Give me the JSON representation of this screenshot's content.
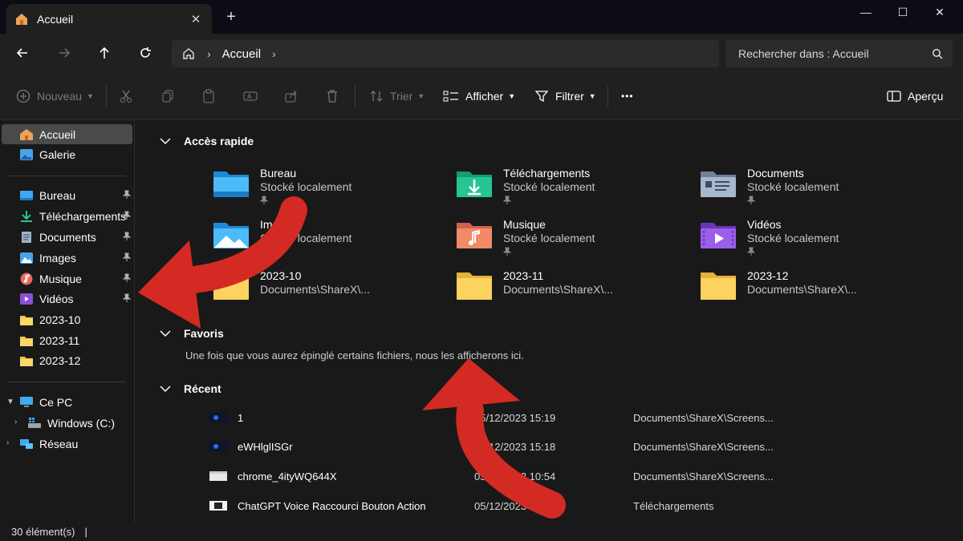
{
  "tab": {
    "title": "Accueil",
    "close": "✕",
    "new": "+"
  },
  "window": {
    "minimize": "—",
    "maximize": "☐",
    "close": "✕"
  },
  "address": {
    "location": "Accueil",
    "sep": "›",
    "trail_sep": "›"
  },
  "search": {
    "placeholder": "Rechercher dans : Accueil"
  },
  "toolbar": {
    "new_label": "Nouveau",
    "sort_label": "Trier",
    "view_label": "Afficher",
    "filter_label": "Filtrer",
    "more": "•••",
    "preview_label": "Aperçu"
  },
  "sidebar": {
    "top": [
      {
        "label": "Accueil",
        "icon": "home-icon"
      },
      {
        "label": "Galerie",
        "icon": "gallery-icon"
      }
    ],
    "pinned": [
      {
        "label": "Bureau",
        "icon": "desktop-icon"
      },
      {
        "label": "Téléchargements",
        "icon": "downloads-icon"
      },
      {
        "label": "Documents",
        "icon": "documents-icon"
      },
      {
        "label": "Images",
        "icon": "pictures-icon"
      },
      {
        "label": "Musique",
        "icon": "music-icon"
      },
      {
        "label": "Vidéos",
        "icon": "videos-icon"
      }
    ],
    "folders": [
      {
        "label": "2023-10",
        "icon": "folder-icon"
      },
      {
        "label": "2023-11",
        "icon": "folder-icon"
      },
      {
        "label": "2023-12",
        "icon": "folder-icon"
      }
    ],
    "pc": {
      "label": "Ce PC",
      "icon": "pc-icon"
    },
    "drive": {
      "label": "Windows (C:)",
      "icon": "drive-icon"
    },
    "network": {
      "label": "Réseau",
      "icon": "network-icon"
    }
  },
  "sections": {
    "quick_access": "Accès rapide",
    "favorites": "Favoris",
    "favorites_empty": "Une fois que vous aurez épinglé certains fichiers, nous les afficherons ici.",
    "recent": "Récent"
  },
  "quick_access": [
    {
      "name": "Bureau",
      "sub": "Stocké localement",
      "pinned": true,
      "icon": "desktop-folder-icon"
    },
    {
      "name": "Téléchargements",
      "sub": "Stocké localement",
      "pinned": true,
      "icon": "downloads-folder-icon"
    },
    {
      "name": "Documents",
      "sub": "Stocké localement",
      "pinned": true,
      "icon": "documents-folder-icon"
    },
    {
      "name": "Images",
      "sub": "Stocké localement",
      "pinned": false,
      "icon": "pictures-folder-icon"
    },
    {
      "name": "Musique",
      "sub": "Stocké localement",
      "pinned": true,
      "icon": "music-folder-icon"
    },
    {
      "name": "Vidéos",
      "sub": "Stocké localement",
      "pinned": true,
      "icon": "videos-folder-icon"
    },
    {
      "name": "2023-10",
      "sub": "Documents\\ShareX\\...",
      "pinned": false,
      "icon": "folder-icon"
    },
    {
      "name": "2023-11",
      "sub": "Documents\\ShareX\\...",
      "pinned": false,
      "icon": "folder-icon"
    },
    {
      "name": "2023-12",
      "sub": "Documents\\ShareX\\...",
      "pinned": false,
      "icon": "folder-icon"
    }
  ],
  "recent": [
    {
      "name": "1",
      "date": "05/12/2023 15:19",
      "location": "Documents\\ShareX\\Screens..."
    },
    {
      "name": "eWHlglISGr",
      "date": "05/12/2023 15:18",
      "location": "Documents\\ShareX\\Screens..."
    },
    {
      "name": "chrome_4ityWQ644X",
      "date": "05/12/2023 10:54",
      "location": "Documents\\ShareX\\Screens..."
    },
    {
      "name": "ChatGPT Voice Raccourci Bouton Action",
      "date": "05/12/2023 15:06",
      "location": "Téléchargements"
    }
  ],
  "status": {
    "count": "30 élément(s)",
    "cursor": "|"
  },
  "colors": {
    "accent_arrow": "#d32b23",
    "folder_yellow": "#f4c542",
    "sidebar_active": "#4a4a4a"
  }
}
